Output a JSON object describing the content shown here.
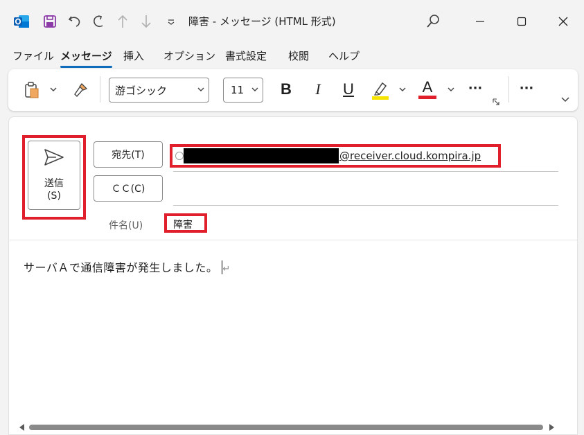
{
  "window": {
    "title": "障害  -  メッセージ (HTML 形式)"
  },
  "menu": {
    "tabs": [
      {
        "label": "ファイル",
        "active": false
      },
      {
        "label": "メッセージ",
        "active": true
      },
      {
        "label": "挿入",
        "active": false
      },
      {
        "label": "オプション",
        "active": false
      },
      {
        "label": "書式設定",
        "active": false
      },
      {
        "label": "校閲",
        "active": false
      },
      {
        "label": "ヘルプ",
        "active": false
      }
    ]
  },
  "ribbon": {
    "font_name": "游ゴシック",
    "font_size": "11",
    "bold": "B",
    "italic": "I",
    "underline": "U",
    "font_color_letter": "A",
    "more": "···",
    "highlight_color": "#f5e400",
    "font_color": "#e01e2c"
  },
  "compose": {
    "send_label": "送信\n(S)",
    "to_button": "宛先(T)",
    "cc_button": "ＣＣ(C)",
    "recipient_domain": "@receiver.cloud.kompira.jp",
    "subject_label": "件名(U)",
    "subject_value": "障害",
    "body": "サーバＡで通信障害が発生しました。",
    "paragraph_mark": "↵"
  },
  "colors": {
    "accent": "#0f6cbd",
    "annotation_red": "#e01e2c"
  },
  "icons": {
    "app": "outlook-icon",
    "save": "save-icon",
    "undo": "undo-icon",
    "redo": "redo-icon",
    "send": "send-arrow-icon"
  }
}
